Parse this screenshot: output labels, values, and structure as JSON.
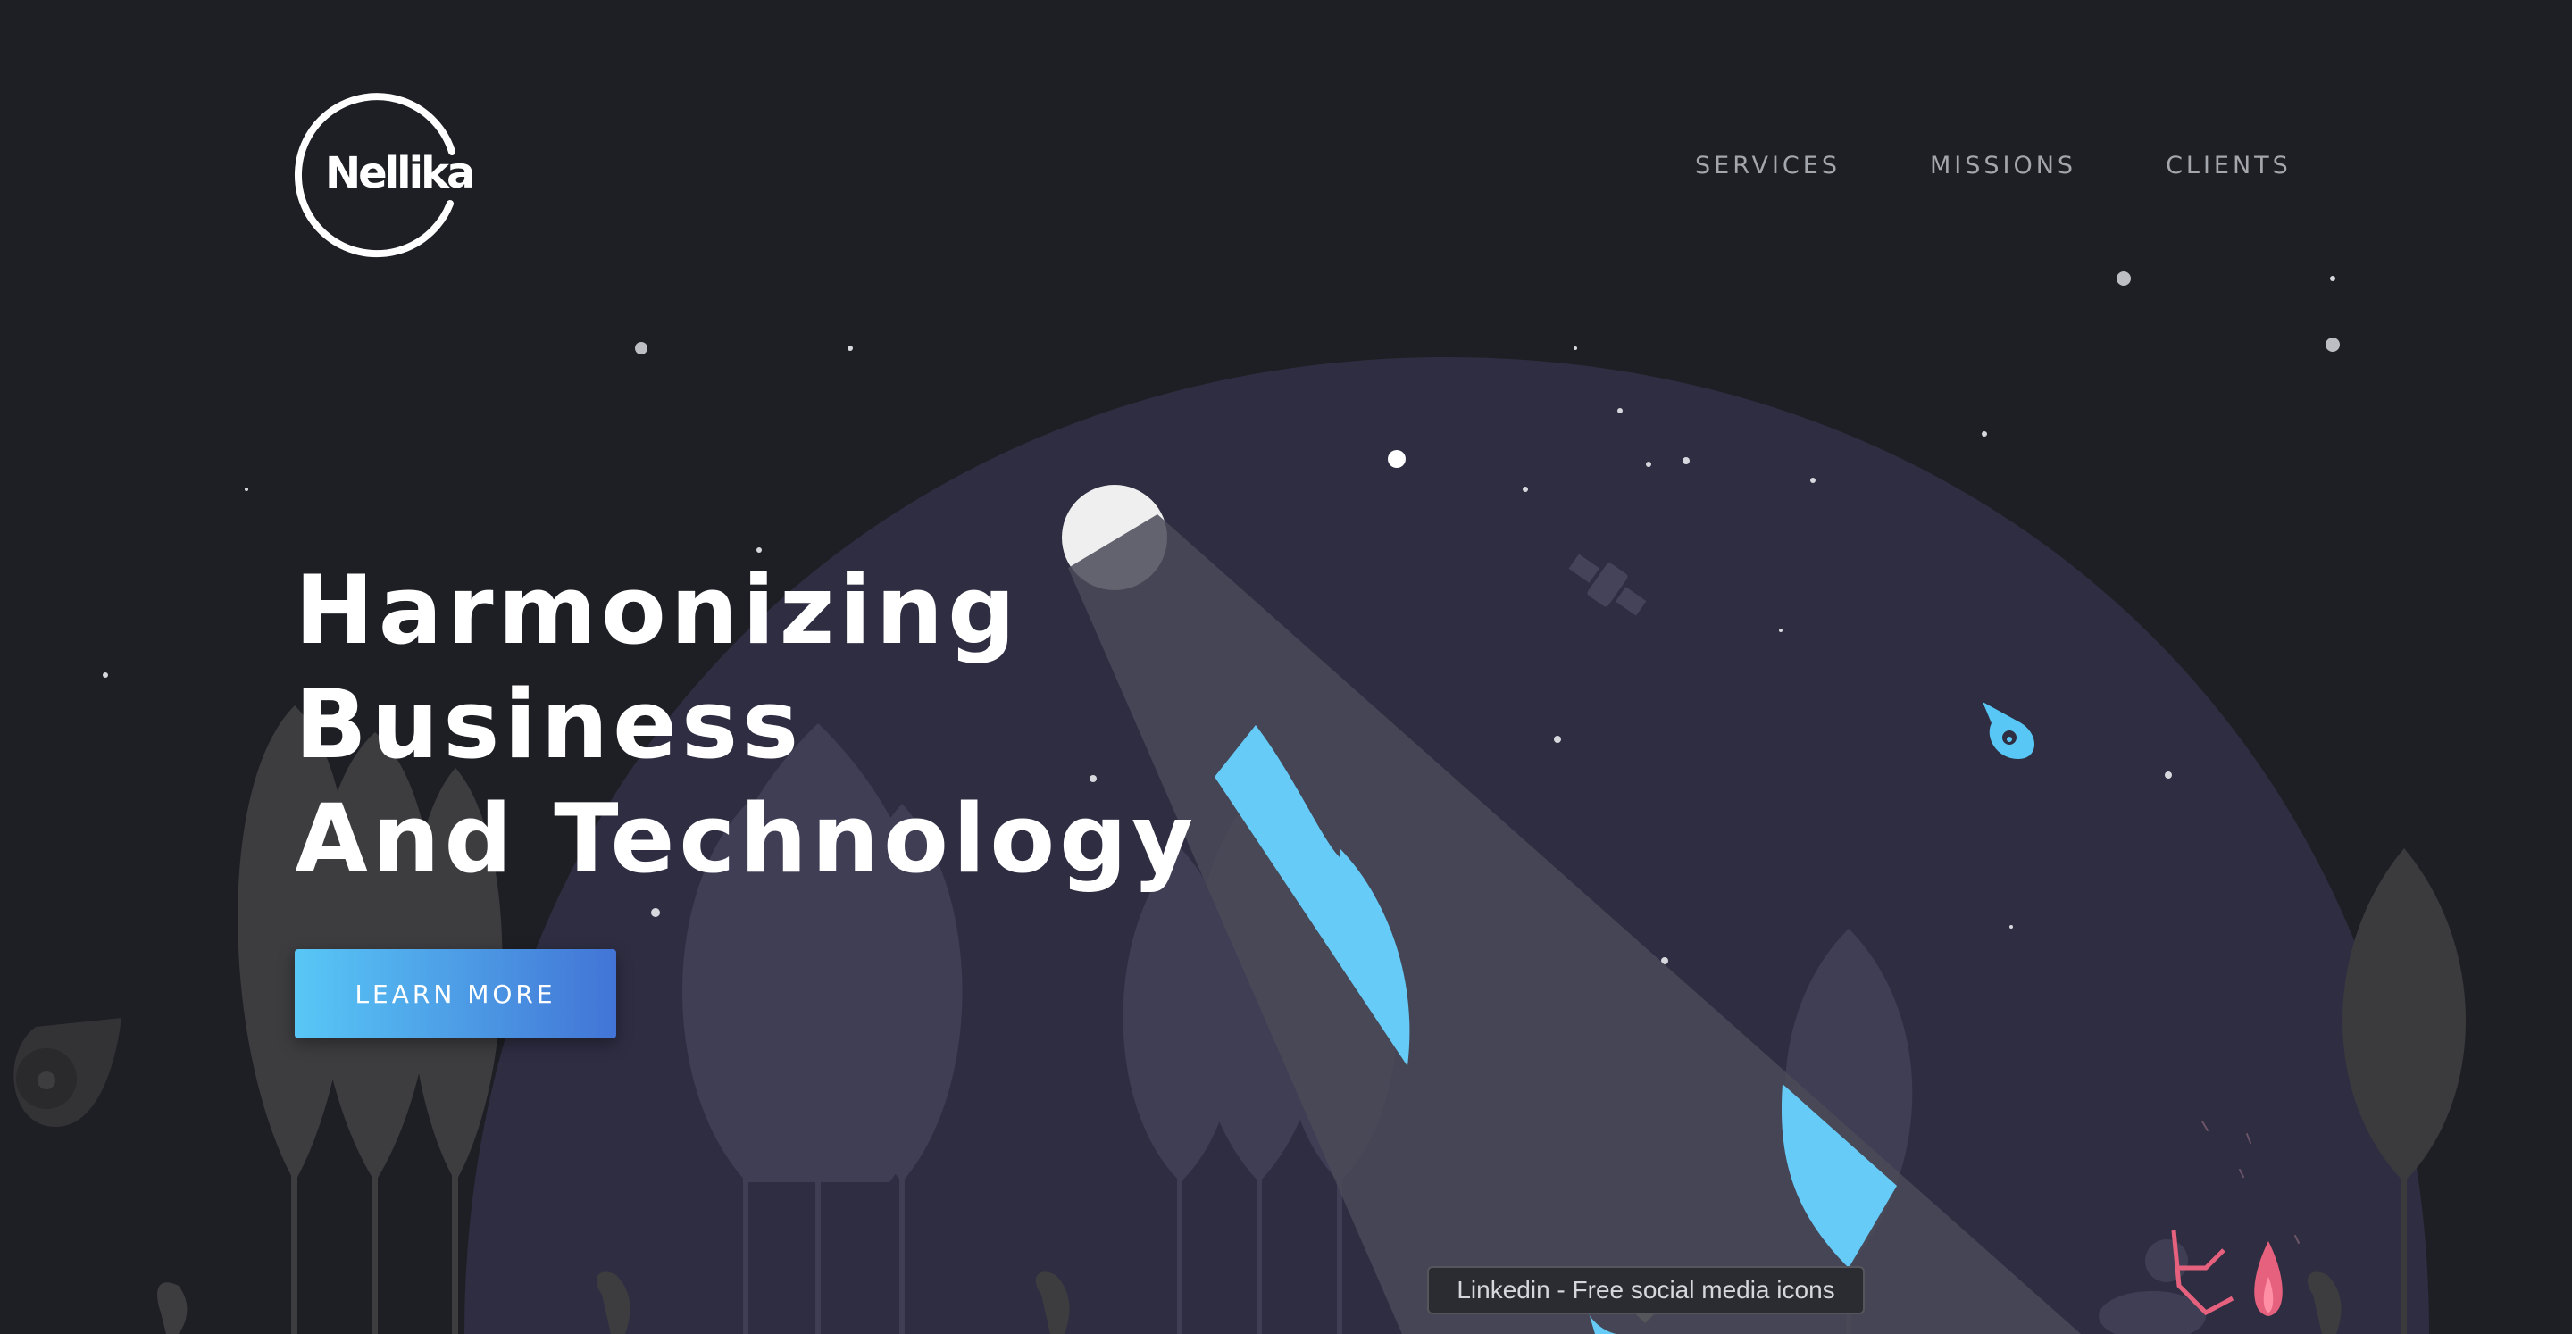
{
  "brand": {
    "logo_text": "Nellika",
    "accent_color": "#58c7f6",
    "accent_color_end": "#4274d6",
    "planet_color": "#2e2d42",
    "background_color": "#1e1f24"
  },
  "nav": {
    "items": [
      {
        "label": "SERVICES"
      },
      {
        "label": "MISSIONS"
      },
      {
        "label": "CLIENTS"
      }
    ]
  },
  "hero": {
    "title_lines": [
      "Harmonizing",
      "Business",
      "And Technology"
    ],
    "cta_label": "LEARN MORE"
  },
  "tooltip": {
    "text": "Linkedin - Free social media icons"
  }
}
